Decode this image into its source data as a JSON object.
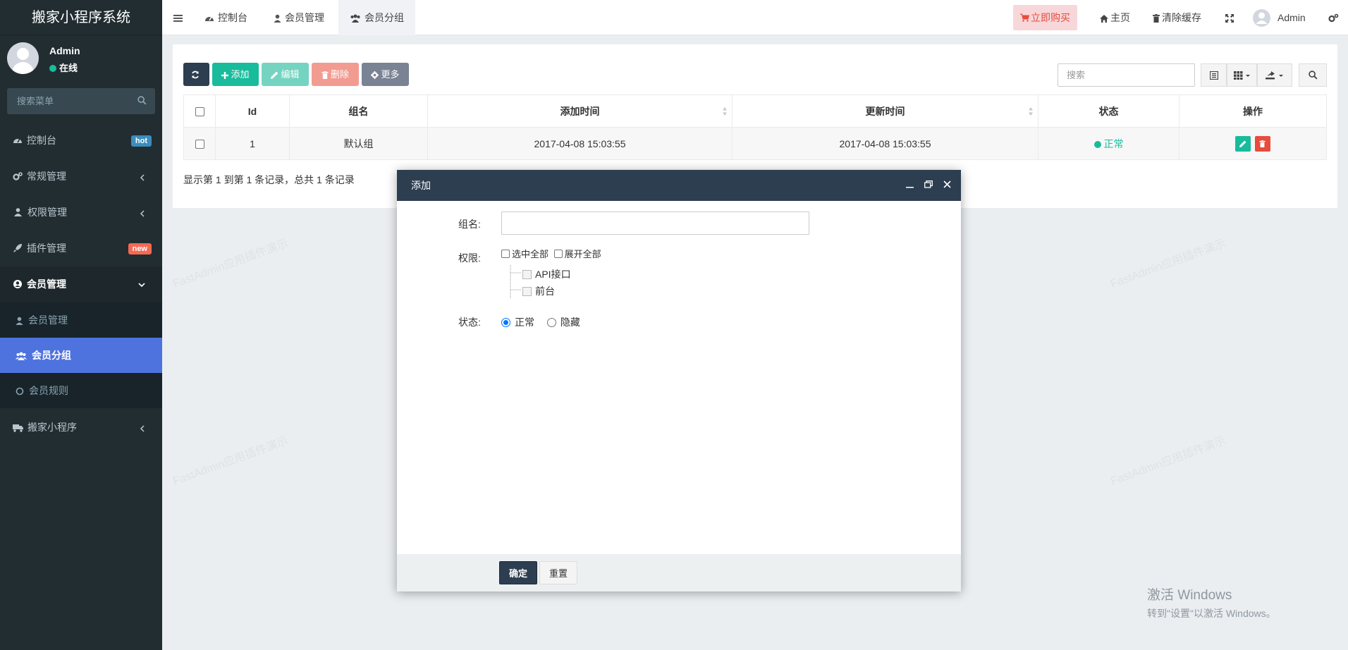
{
  "sidebar": {
    "logo": "搬家小程序系统",
    "user": {
      "name": "Admin",
      "status": "在线"
    },
    "search_placeholder": "搜索菜单",
    "items": [
      {
        "label": "控制台",
        "badge": "hot",
        "badge_color": "#3c8dbc"
      },
      {
        "label": "常规管理"
      },
      {
        "label": "权限管理"
      },
      {
        "label": "插件管理",
        "badge": "new",
        "badge_color": "#f56954"
      },
      {
        "label": "会员管理"
      },
      {
        "label": "搬家小程序"
      }
    ],
    "sub_items": [
      {
        "label": "会员管理"
      },
      {
        "label": "会员分组"
      },
      {
        "label": "会员规则"
      }
    ]
  },
  "topnav": {
    "tabs": [
      {
        "label": "控制台"
      },
      {
        "label": "会员管理"
      },
      {
        "label": "会员分组"
      }
    ],
    "buy": "立即购买",
    "home": "主页",
    "clear_cache": "清除缓存",
    "user": "Admin"
  },
  "toolbar": {
    "add": "添加",
    "edit": "编辑",
    "delete": "删除",
    "more": "更多",
    "search_placeholder": "搜索"
  },
  "table": {
    "columns": [
      "Id",
      "组名",
      "添加时间",
      "更新时间",
      "状态",
      "操作"
    ],
    "rows": [
      {
        "id": "1",
        "name": "默认组",
        "created": "2017-04-08 15:03:55",
        "updated": "2017-04-08 15:03:55",
        "status": "正常"
      }
    ],
    "page_info": "显示第 1 到第 1 条记录，总共 1 条记录"
  },
  "dialog": {
    "title": "添加",
    "name_label": "组名:",
    "perm_label": "权限:",
    "select_all": "选中全部",
    "expand_all": "展开全部",
    "tree": [
      "API接口",
      "前台"
    ],
    "status_label": "状态:",
    "status_options": [
      "正常",
      "隐藏"
    ],
    "confirm": "确定",
    "reset": "重置"
  },
  "windows_mark": {
    "line1": "激活 Windows",
    "line2": "转到\"设置\"以激活 Windows。"
  },
  "watermark": "FastAdmin应用插件演示",
  "colors": {
    "sidebar": "#222d32",
    "accent": "#18bc9c",
    "active": "#4e73df",
    "dialog_header": "#2c3e50"
  }
}
